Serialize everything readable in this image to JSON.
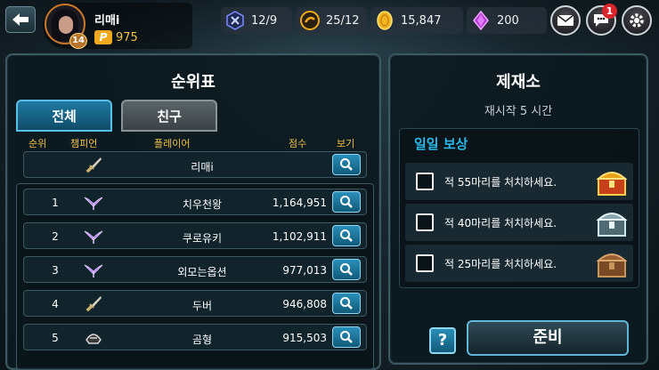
{
  "profile": {
    "name": "리매i",
    "level": "14",
    "points_icon": "P",
    "points": "975"
  },
  "resources": {
    "energy": "12/9",
    "tokens": "25/12",
    "gold": "15,847",
    "gems": "200"
  },
  "notifications": {
    "chat_count": "1"
  },
  "leaderboard": {
    "title": "순위표",
    "tabs": {
      "all": "전체",
      "friends": "친구"
    },
    "headers": {
      "rank": "순위",
      "champion": "챔피언",
      "player": "플레이어",
      "score": "점수",
      "view": "보기"
    },
    "me": {
      "rank": "",
      "champion_icon": "sword-icon",
      "player": "리매i",
      "score": ""
    },
    "rows": [
      {
        "rank": "1",
        "champion_icon": "purple-wing-icon",
        "player": "치우천왕",
        "score": "1,164,951"
      },
      {
        "rank": "2",
        "champion_icon": "purple-wing-icon",
        "player": "쿠로유키",
        "score": "1,102,911"
      },
      {
        "rank": "3",
        "champion_icon": "purple-wing-icon",
        "player": "외모는옵션",
        "score": "977,013"
      },
      {
        "rank": "4",
        "champion_icon": "sword-icon",
        "player": "두버",
        "score": "946,808"
      },
      {
        "rank": "5",
        "champion_icon": "helmet-icon",
        "player": "곰형",
        "score": "915,503"
      }
    ]
  },
  "forge": {
    "title": "제재소",
    "restart": "재시작 5 시간",
    "daily_title": "일일 보상",
    "missions": [
      {
        "text": "적 55마리를 처치하세요.",
        "chest": "gold-chest-icon",
        "checked": false
      },
      {
        "text": "적 40마리를 처치하세요.",
        "chest": "silver-chest-icon",
        "checked": false
      },
      {
        "text": "적 25마리를 처치하세요.",
        "chest": "wood-chest-icon",
        "checked": false
      }
    ],
    "help_label": "?",
    "ready_label": "준비"
  },
  "colors": {
    "accent": "#29b8e8",
    "header_gold": "#f2c14a",
    "panel_border": "#3c5862",
    "notif_red": "#d8262c"
  }
}
